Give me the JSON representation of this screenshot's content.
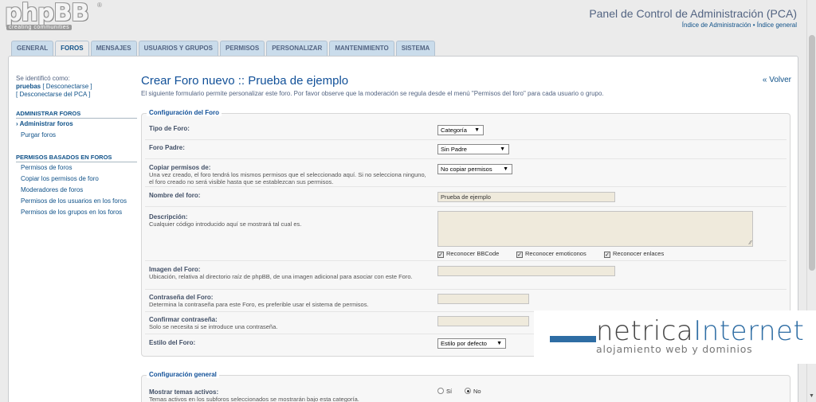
{
  "header": {
    "logo_word": "phpBB",
    "logo_tag": "creating communities",
    "logo_reg": "®",
    "title": "Panel de Control de Administración (PCA)",
    "links": "Índice de Administración • Índice general"
  },
  "tabs": [
    {
      "label": "GENERAL",
      "active": false
    },
    {
      "label": "FOROS",
      "active": true
    },
    {
      "label": "MENSAJES",
      "active": false
    },
    {
      "label": "USUARIOS Y GRUPOS",
      "active": false
    },
    {
      "label": "PERMISOS",
      "active": false
    },
    {
      "label": "PERSONALIZAR",
      "active": false
    },
    {
      "label": "MANTENIMIENTO",
      "active": false
    },
    {
      "label": "SISTEMA",
      "active": false
    }
  ],
  "sidebar": {
    "logged_as": "Se identificó como:",
    "username": "pruebas",
    "logout": "[ Desconectarse ]",
    "logout_acp": "[ Desconectarse del PCA ]",
    "section1": "ADMINISTRAR FOROS",
    "section1_items": [
      "Administrar foros",
      "Purgar foros"
    ],
    "section2": "PERMISOS BASADOS EN FOROS",
    "section2_items": [
      "Permisos de foros",
      "Copiar los permisos de foro",
      "Moderadores de foros",
      "Permisos de los usuarios en los foros",
      "Permisos de los grupos en los foros"
    ]
  },
  "content": {
    "title": "Crear Foro nuevo :: Prueba de ejemplo",
    "back": "« Volver",
    "intro": "El siguiente formulario permite personalizar este foro. Por favor observe que la moderación se regula desde el menú \"Permisos del foro\" para cada usuario o grupo."
  },
  "forum_settings": {
    "legend": "Configuración del Foro",
    "type_label": "Tipo de Foro:",
    "type_value": "Categoría",
    "parent_label": "Foro Padre:",
    "parent_value": "Sin Padre",
    "copy_label": "Copiar permisos de:",
    "copy_desc": "Una vez creado, el foro tendrá los mismos permisos que el seleccionado aquí. Si no selecciona ninguno, el foro creado no será visible hasta que se establezcan sus permisos.",
    "copy_value": "No copiar permisos",
    "name_label": "Nombre del foro:",
    "name_value": "Prueba de ejemplo",
    "desc_label": "Descripción:",
    "desc_desc": "Cualquier código introducido aquí se mostrará tal cual es.",
    "chk_bbcode": "Reconocer BBCode",
    "chk_smilies": "Reconocer emoticonos",
    "chk_links": "Reconocer enlaces",
    "image_label": "Imagen del Foro:",
    "image_desc": "Ubicación, relativa al directorio raíz de phpBB, de una imagen adicional para asociar con este Foro.",
    "password_label": "Contraseña del Foro:",
    "password_desc": "Determina la contraseña para este Foro, es preferible usar el sistema de permisos.",
    "confirm_label": "Confirmar contraseña:",
    "confirm_desc": "Solo se necesita si se introduce una contraseña.",
    "style_label": "Estilo del Foro:",
    "style_value": "Estilo por defecto"
  },
  "general_settings": {
    "legend": "Configuración general",
    "active_label": "Mostrar temas activos:",
    "active_desc": "Temas activos en los subforos seleccionados se mostrarán bajo esta categoría.",
    "yes": "Sí",
    "no": "No"
  },
  "ad": {
    "brand_a": "netrica",
    "brand_b": "Internet",
    "sub": "alojamiento web y dominios",
    "accent": "#2e6da4"
  }
}
